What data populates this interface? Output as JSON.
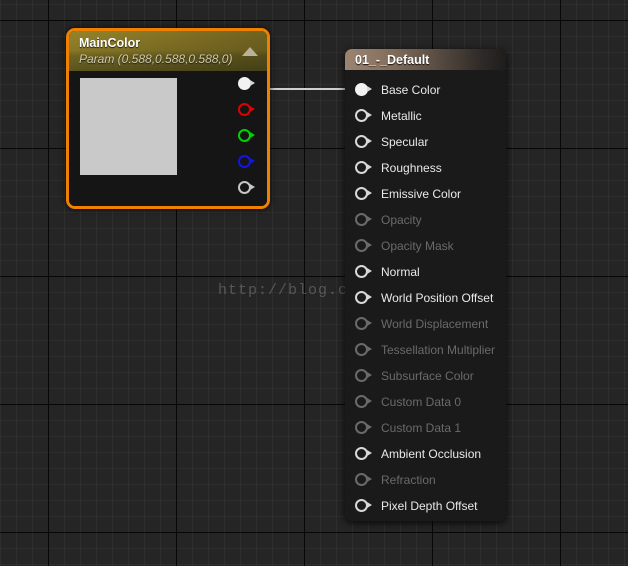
{
  "editor": {
    "name": "material-graph-editor",
    "background_color": "#252525",
    "grid_minor_color": "#2d2d2d",
    "grid_major_color": "#000000"
  },
  "watermark": {
    "text": "http://blog.csdn.net/"
  },
  "wire": {
    "color": "#cfcfcf",
    "from_pin": "rgba-output",
    "to_pin": "base-color-input"
  },
  "param_node": {
    "title": "MainColor",
    "subtitle": "Param (0.588,0.588,0.588,0)",
    "selected": true,
    "selection_color": "#F08000",
    "header_color": "#96842a",
    "swatch_color": "#c9c9c9",
    "collapse_arrow": "triangle-up-icon",
    "output_pins": [
      {
        "name": "rgba",
        "label": "",
        "color": "#f2f2f2",
        "filled": true,
        "class": "filled"
      },
      {
        "name": "r",
        "label": "",
        "color": "#e00000",
        "filled": false,
        "class": "c-red"
      },
      {
        "name": "g",
        "label": "",
        "color": "#00d400",
        "filled": false,
        "class": "c-green"
      },
      {
        "name": "b",
        "label": "",
        "color": "#1414e6",
        "filled": false,
        "class": "c-blue"
      },
      {
        "name": "a",
        "label": "",
        "color": "#c6c6c6",
        "filled": false,
        "class": "c-gray"
      }
    ]
  },
  "material_node": {
    "title": "01_-_Default",
    "header_color": "#9c8471",
    "input_pins": [
      {
        "label": "Base Color",
        "enabled": true,
        "connected": true
      },
      {
        "label": "Metallic",
        "enabled": true,
        "connected": false
      },
      {
        "label": "Specular",
        "enabled": true,
        "connected": false
      },
      {
        "label": "Roughness",
        "enabled": true,
        "connected": false
      },
      {
        "label": "Emissive Color",
        "enabled": true,
        "connected": false
      },
      {
        "label": "Opacity",
        "enabled": false,
        "connected": false
      },
      {
        "label": "Opacity Mask",
        "enabled": false,
        "connected": false
      },
      {
        "label": "Normal",
        "enabled": true,
        "connected": false
      },
      {
        "label": "World Position Offset",
        "enabled": true,
        "connected": false
      },
      {
        "label": "World Displacement",
        "enabled": false,
        "connected": false
      },
      {
        "label": "Tessellation Multiplier",
        "enabled": false,
        "connected": false
      },
      {
        "label": "Subsurface Color",
        "enabled": false,
        "connected": false
      },
      {
        "label": "Custom Data 0",
        "enabled": false,
        "connected": false
      },
      {
        "label": "Custom Data 1",
        "enabled": false,
        "connected": false
      },
      {
        "label": "Ambient Occlusion",
        "enabled": true,
        "connected": false
      },
      {
        "label": "Refraction",
        "enabled": false,
        "connected": false
      },
      {
        "label": "Pixel Depth Offset",
        "enabled": true,
        "connected": false
      }
    ]
  }
}
